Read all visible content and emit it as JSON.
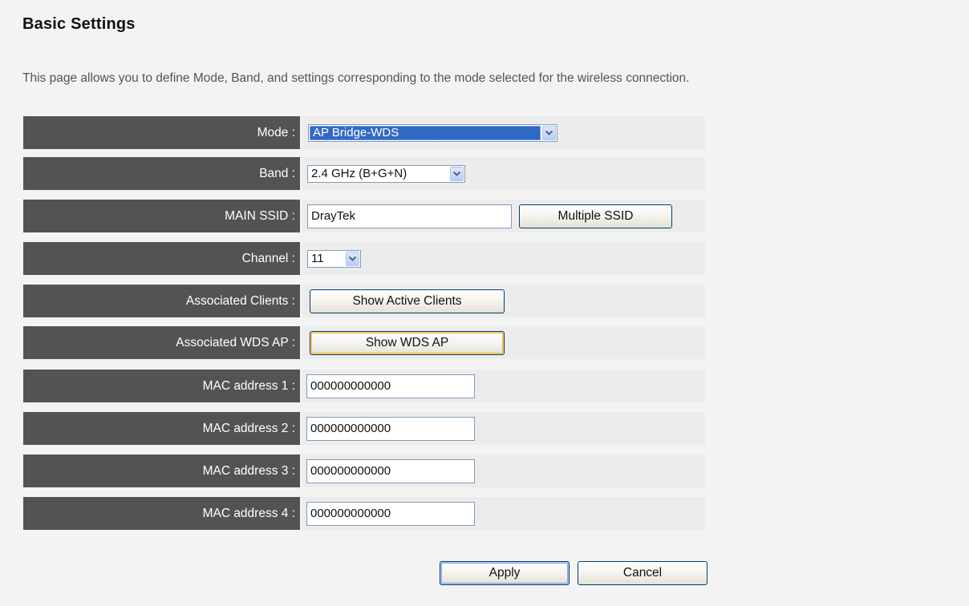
{
  "page": {
    "title": "Basic Settings",
    "description": "This page allows you to define Mode, Band, and settings corresponding to the mode selected for the wireless connection."
  },
  "form": {
    "mode": {
      "label": "Mode :",
      "value": "AP Bridge-WDS"
    },
    "band": {
      "label": "Band :",
      "value": "2.4 GHz (B+G+N)"
    },
    "main_ssid": {
      "label": "MAIN SSID :",
      "value": "DrayTek",
      "button": "Multiple SSID"
    },
    "channel": {
      "label": "Channel :",
      "value": "11"
    },
    "associated_clients": {
      "label": "Associated Clients :",
      "button": "Show Active Clients"
    },
    "associated_wds_ap": {
      "label": "Associated WDS AP :",
      "button": "Show WDS AP"
    },
    "mac_addresses": [
      {
        "label": "MAC address 1 :",
        "value": "000000000000"
      },
      {
        "label": "MAC address 2 :",
        "value": "000000000000"
      },
      {
        "label": "MAC address 3 :",
        "value": "000000000000"
      },
      {
        "label": "MAC address 4 :",
        "value": "000000000000"
      }
    ]
  },
  "actions": {
    "apply": "Apply",
    "cancel": "Cancel"
  },
  "icons": {
    "dropdown": "chevron-down-icon"
  },
  "colors": {
    "label_background": "#535353",
    "content_background": "#ececec",
    "page_background": "#f3f3f3",
    "selection_highlight": "#316ac5"
  }
}
